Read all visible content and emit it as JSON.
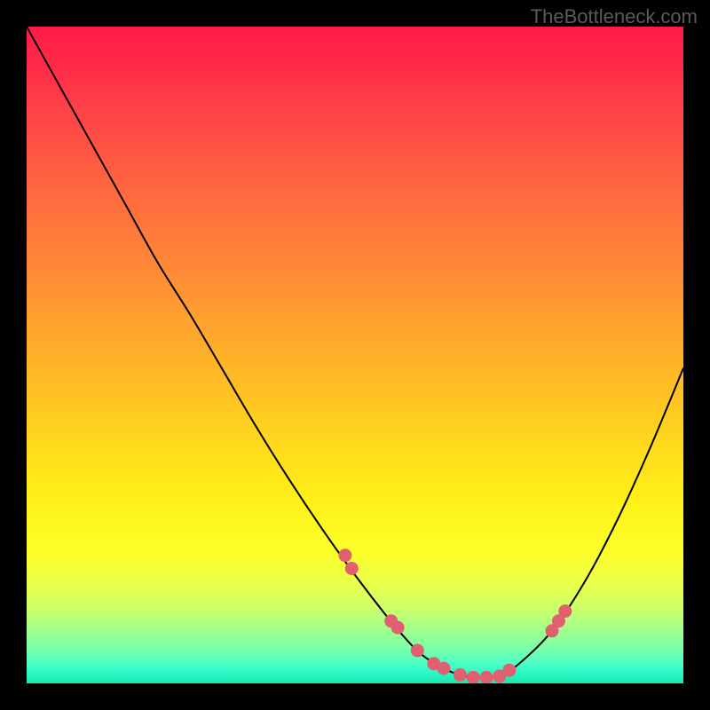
{
  "attribution": "TheBottleneck.com",
  "chart_data": {
    "type": "line",
    "title": "",
    "xlabel": "",
    "ylabel": "",
    "xlim": [
      0,
      100
    ],
    "ylim": [
      0,
      100
    ],
    "series": [
      {
        "name": "curve",
        "x": [
          0,
          5,
          10,
          15,
          20,
          25,
          30,
          35,
          40,
          45,
          50,
          55,
          58,
          60,
          63,
          66,
          69,
          72,
          75,
          80,
          85,
          90,
          95,
          100
        ],
        "y": [
          100,
          91,
          82,
          73,
          64,
          56,
          47.5,
          39,
          31,
          23.5,
          16.5,
          10,
          6.5,
          4.5,
          2.5,
          1.3,
          0.8,
          1.2,
          3,
          8,
          15.5,
          25,
          36,
          48
        ]
      }
    ],
    "points": {
      "name": "markers",
      "x": [
        48.5,
        49.5,
        55.5,
        56.5,
        59.5,
        62.0,
        63.5,
        66.0,
        68.0,
        70.0,
        72.0,
        73.5,
        80.0,
        81.0,
        82.0
      ],
      "y": [
        19.5,
        17.5,
        9.5,
        8.5,
        5.0,
        3.0,
        2.3,
        1.3,
        0.9,
        0.9,
        1.1,
        2.0,
        8.0,
        9.5,
        11.0
      ]
    }
  }
}
